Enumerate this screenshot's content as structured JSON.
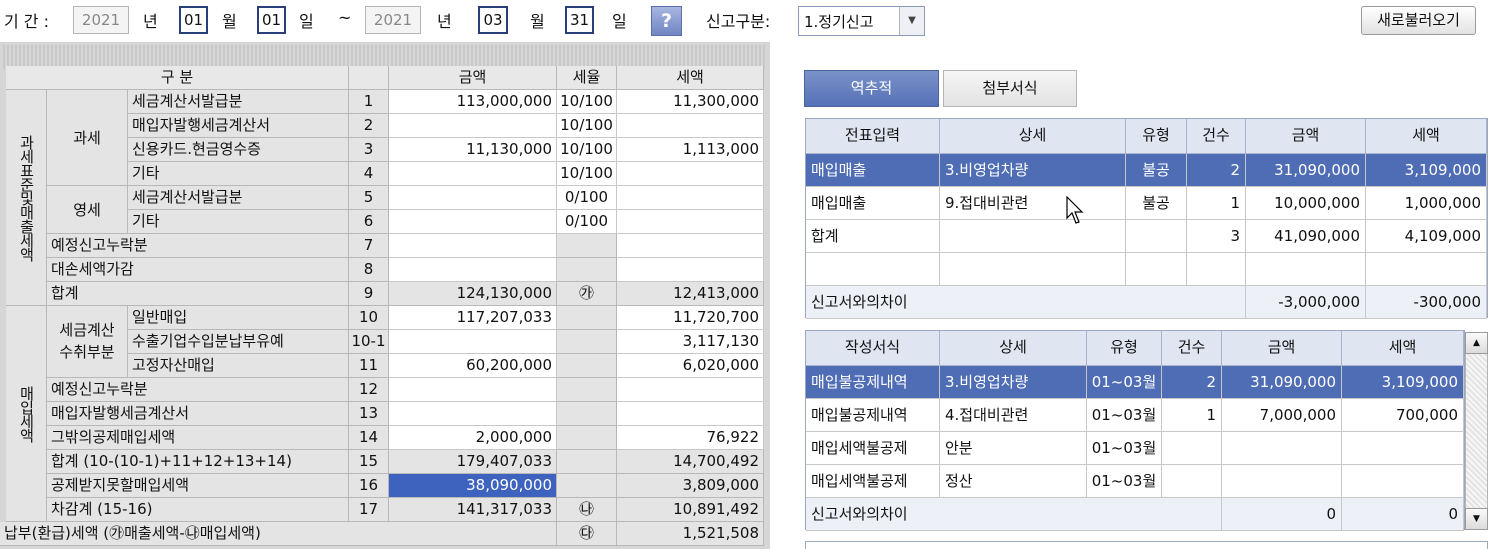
{
  "period": {
    "label": "기 간 :",
    "from_year": "2021",
    "y1": "년",
    "from_month": "01",
    "m1": "월",
    "from_day": "01",
    "d1": "일",
    "tilde": "~",
    "to_year": "2021",
    "y2": "년",
    "to_month": "03",
    "m2": "월",
    "to_day": "31",
    "d2": "일",
    "help": "?"
  },
  "report_type": {
    "label": "신고구분:",
    "value": "1.정기신고"
  },
  "reload_button": "새로불러오기",
  "left_table": {
    "headers": {
      "category": "구 분",
      "amount": "금액",
      "rate": "세율",
      "tax": "세액"
    },
    "group_sales": "과세표준및매출세액",
    "group_purchase": "매입세액",
    "sub_taxable": "과세",
    "sub_zero": "영세",
    "sub_invoice": "세금계산\n수취부분",
    "rows": [
      {
        "label": "세금계산서발급분",
        "no": "1",
        "amount": "113,000,000",
        "rate": "10/100",
        "tax": "11,300,000"
      },
      {
        "label": "매입자발행세금계산서",
        "no": "2",
        "amount": "",
        "rate": "10/100",
        "tax": ""
      },
      {
        "label": "신용카드.현금영수증",
        "no": "3",
        "amount": "11,130,000",
        "rate": "10/100",
        "tax": "1,113,000"
      },
      {
        "label": "기타",
        "no": "4",
        "amount": "",
        "rate": "10/100",
        "tax": ""
      },
      {
        "label": "세금계산서발급분",
        "no": "5",
        "amount": "",
        "rate": "0/100",
        "tax": ""
      },
      {
        "label": "기타",
        "no": "6",
        "amount": "",
        "rate": "0/100",
        "tax": ""
      },
      {
        "label": "예정신고누락분",
        "no": "7",
        "amount": "",
        "rate": "",
        "tax": ""
      },
      {
        "label": "대손세액가감",
        "no": "8",
        "amount": "",
        "rate": "",
        "tax": ""
      },
      {
        "label": "합계",
        "no": "9",
        "amount": "124,130,000",
        "rate": "㉮",
        "tax": "12,413,000"
      },
      {
        "label": "일반매입",
        "no": "10",
        "amount": "117,207,033",
        "rate": "",
        "tax": "11,720,700"
      },
      {
        "label": "수출기업수입분납부유예",
        "no": "10-1",
        "amount": "",
        "rate": "",
        "tax": "3,117,130"
      },
      {
        "label": "고정자산매입",
        "no": "11",
        "amount": "60,200,000",
        "rate": "",
        "tax": "6,020,000"
      },
      {
        "label": "예정신고누락분",
        "no": "12",
        "amount": "",
        "rate": "",
        "tax": ""
      },
      {
        "label": "매입자발행세금계산서",
        "no": "13",
        "amount": "",
        "rate": "",
        "tax": ""
      },
      {
        "label": "그밖의공제매입세액",
        "no": "14",
        "amount": "2,000,000",
        "rate": "",
        "tax": "76,922"
      },
      {
        "label": "합계 (10-(10-1)+11+12+13+14)",
        "no": "15",
        "amount": "179,407,033",
        "rate": "",
        "tax": "14,700,492"
      },
      {
        "label": "공제받지못할매입세액",
        "no": "16",
        "amount": "38,090,000",
        "rate": "",
        "tax": "3,809,000"
      },
      {
        "label": "차감계 (15-16)",
        "no": "17",
        "amount": "141,317,033",
        "rate": "㉯",
        "tax": "10,891,492"
      }
    ],
    "payable": {
      "label": "납부(환급)세액 (㉮매출세액-㉯매입세액)",
      "rate": "㉰",
      "tax": "1,521,508"
    }
  },
  "tabs": [
    "역추적",
    "첨부서식"
  ],
  "voucher_table": {
    "headers": [
      "전표입력",
      "상세",
      "유형",
      "건수",
      "금액",
      "세액"
    ],
    "rows": [
      [
        "매입매출",
        "3.비영업차량",
        "불공",
        "2",
        "31,090,000",
        "3,109,000"
      ],
      [
        "매입매출",
        "9.접대비관련",
        "불공",
        "1",
        "10,000,000",
        "1,000,000"
      ],
      [
        "합계",
        "",
        "",
        "3",
        "41,090,000",
        "4,109,000"
      ],
      [
        "",
        "",
        "",
        "",
        "",
        ""
      ]
    ],
    "diff": {
      "label": "신고서와의차이",
      "amount": "-3,000,000",
      "tax": "-300,000"
    }
  },
  "form_table": {
    "headers": [
      "작성서식",
      "상세",
      "유형",
      "건수",
      "금액",
      "세액"
    ],
    "rows": [
      [
        "매입불공제내역",
        "3.비영업차량",
        "01~03월",
        "2",
        "31,090,000",
        "3,109,000"
      ],
      [
        "매입불공제내역",
        "4.접대비관련",
        "01~03월",
        "1",
        "7,000,000",
        "700,000"
      ],
      [
        "매입세액불공제",
        "안분",
        "01~03월",
        "",
        "",
        ""
      ],
      [
        "매입세액불공제",
        "정산",
        "01~03월",
        "",
        "",
        ""
      ]
    ],
    "diff": {
      "label": "신고서와의차이",
      "amount": "0",
      "tax": "0"
    }
  },
  "colors": {
    "selected_row": "#4f6db4",
    "header_bg": "#dfe5f1",
    "highlight_cell": "#3d63bf"
  }
}
